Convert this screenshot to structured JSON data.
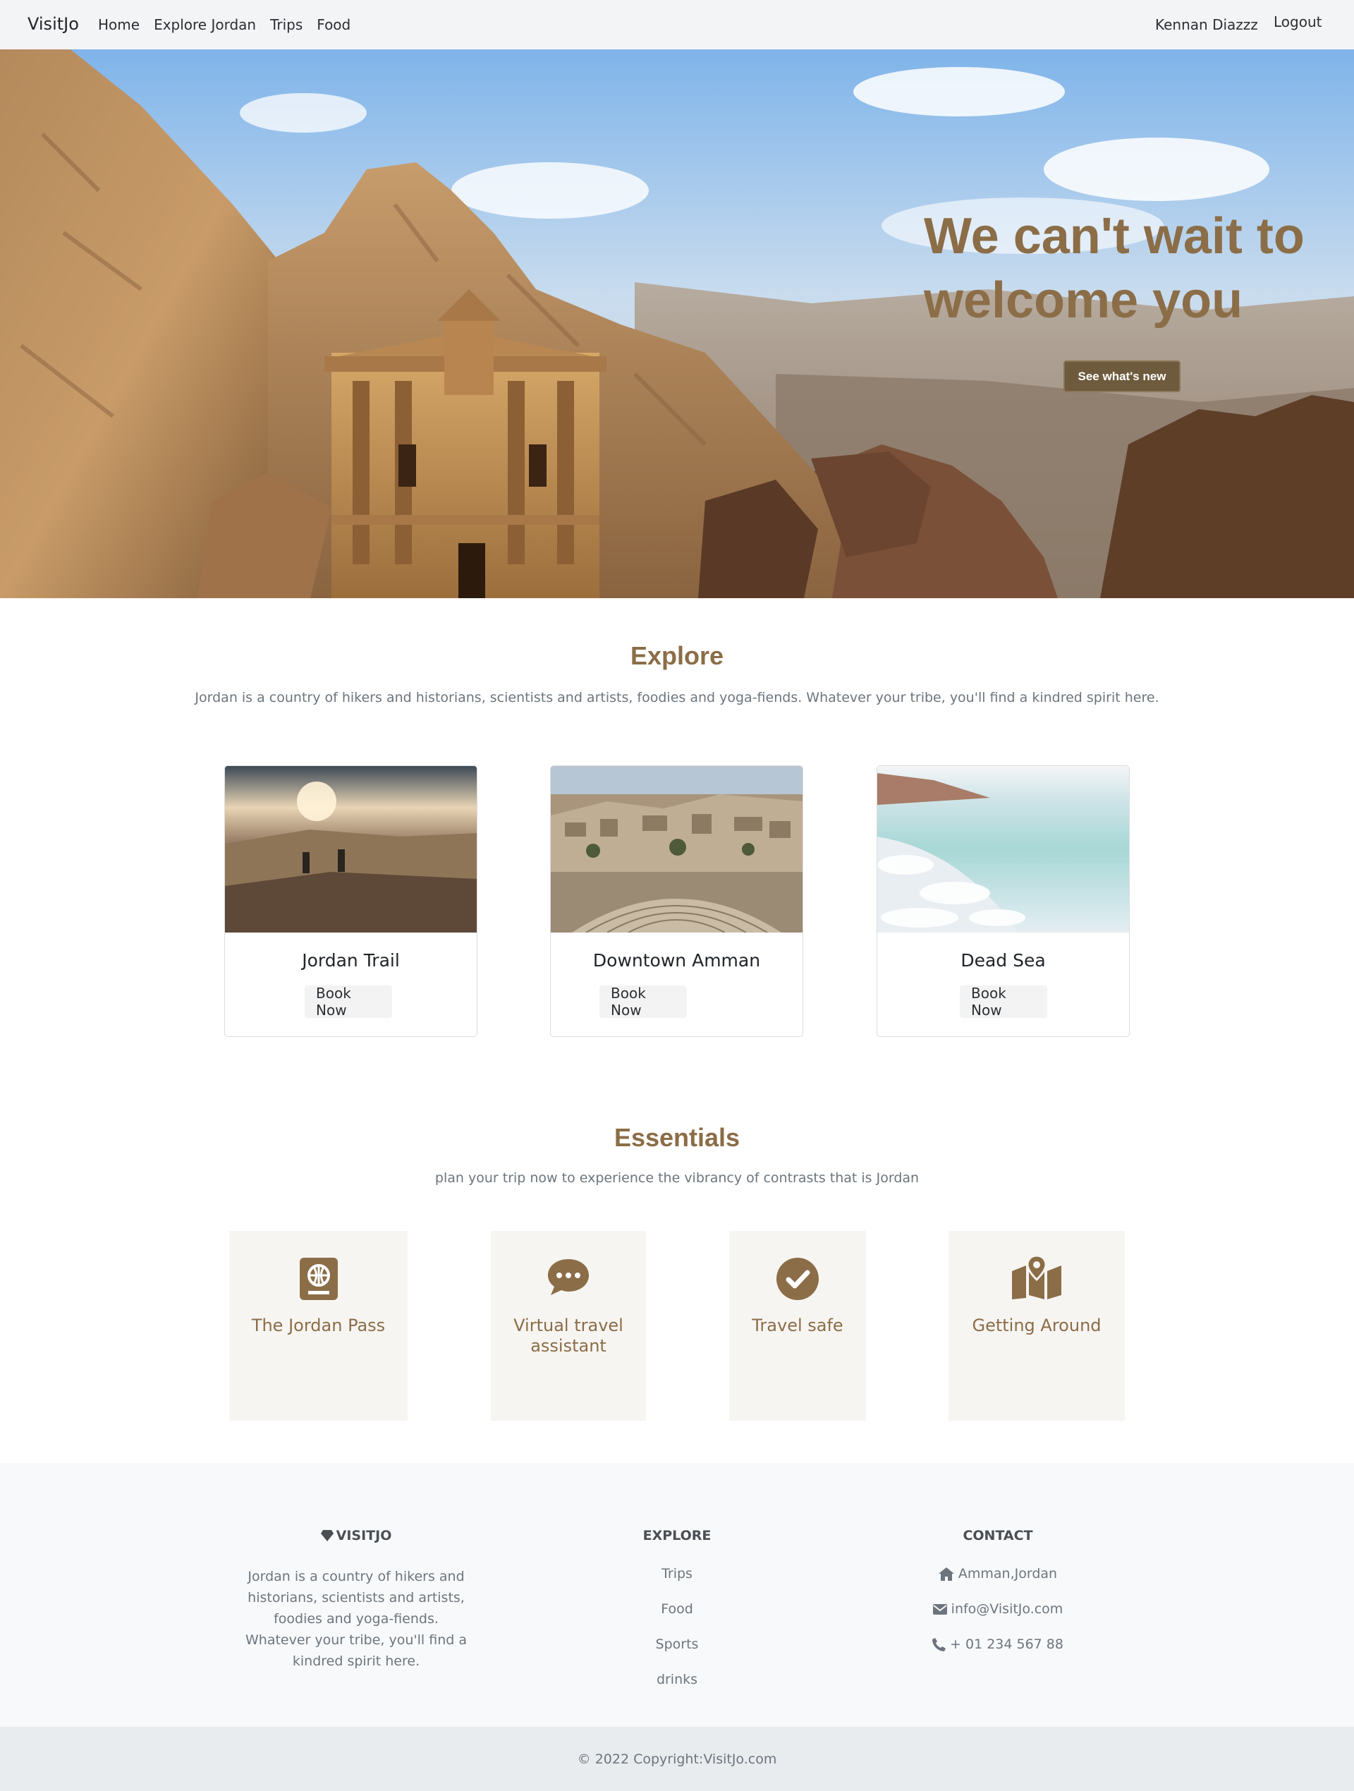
{
  "nav": {
    "brand": "VisitJo",
    "links": [
      "Home",
      "Explore Jordan",
      "Trips",
      "Food"
    ],
    "user": "Kennan Diazzz",
    "logout": "Logout"
  },
  "hero": {
    "title": "We can't wait to welcome you",
    "button": "See what's new"
  },
  "explore": {
    "title": "Explore",
    "subtitle": "Jordan is a country of hikers and historians, scientists and artists, foodies and yoga-fiends. Whatever your tribe, you'll find a kindred spirit here.",
    "cards": [
      {
        "title": "Jordan Trail",
        "button": "Book Now"
      },
      {
        "title": "Downtown Amman",
        "button": "Book Now"
      },
      {
        "title": "Dead Sea",
        "button": "Book Now"
      }
    ]
  },
  "essentials": {
    "title": "Essentials",
    "subtitle": "plan your trip now to experience the vibrancy of contrasts that is Jordan",
    "items": [
      {
        "label": "The Jordan Pass",
        "icon": "passport-icon"
      },
      {
        "label": "Virtual travel assistant",
        "icon": "chat-bubble-icon"
      },
      {
        "label": "Travel safe",
        "icon": "check-circle-icon"
      },
      {
        "label": "Getting Around",
        "icon": "map-icon"
      }
    ]
  },
  "footer": {
    "brand_heading": "VISITJO",
    "brand_text": "Jordan is a country of hikers and historians, scientists and artists, foodies and yoga-fiends. Whatever your tribe, you'll find a kindred spirit here.",
    "explore_heading": "EXPLORE",
    "explore_links": [
      "Trips",
      "Food",
      "Sports",
      "drinks"
    ],
    "contact_heading": "CONTACT",
    "address": "Amman,Jordan",
    "email": "info@VisitJo.com",
    "phone": "+ 01 234 567 88",
    "copyright": "© 2022 Copyright:VisitJo.com"
  },
  "colors": {
    "accent": "#8b6d47",
    "button_dark": "#6e5a3c",
    "essentials_bg": "#f7f5f2",
    "footer_bg": "#f8f9fa",
    "copyright_bg": "#e9ecef"
  }
}
